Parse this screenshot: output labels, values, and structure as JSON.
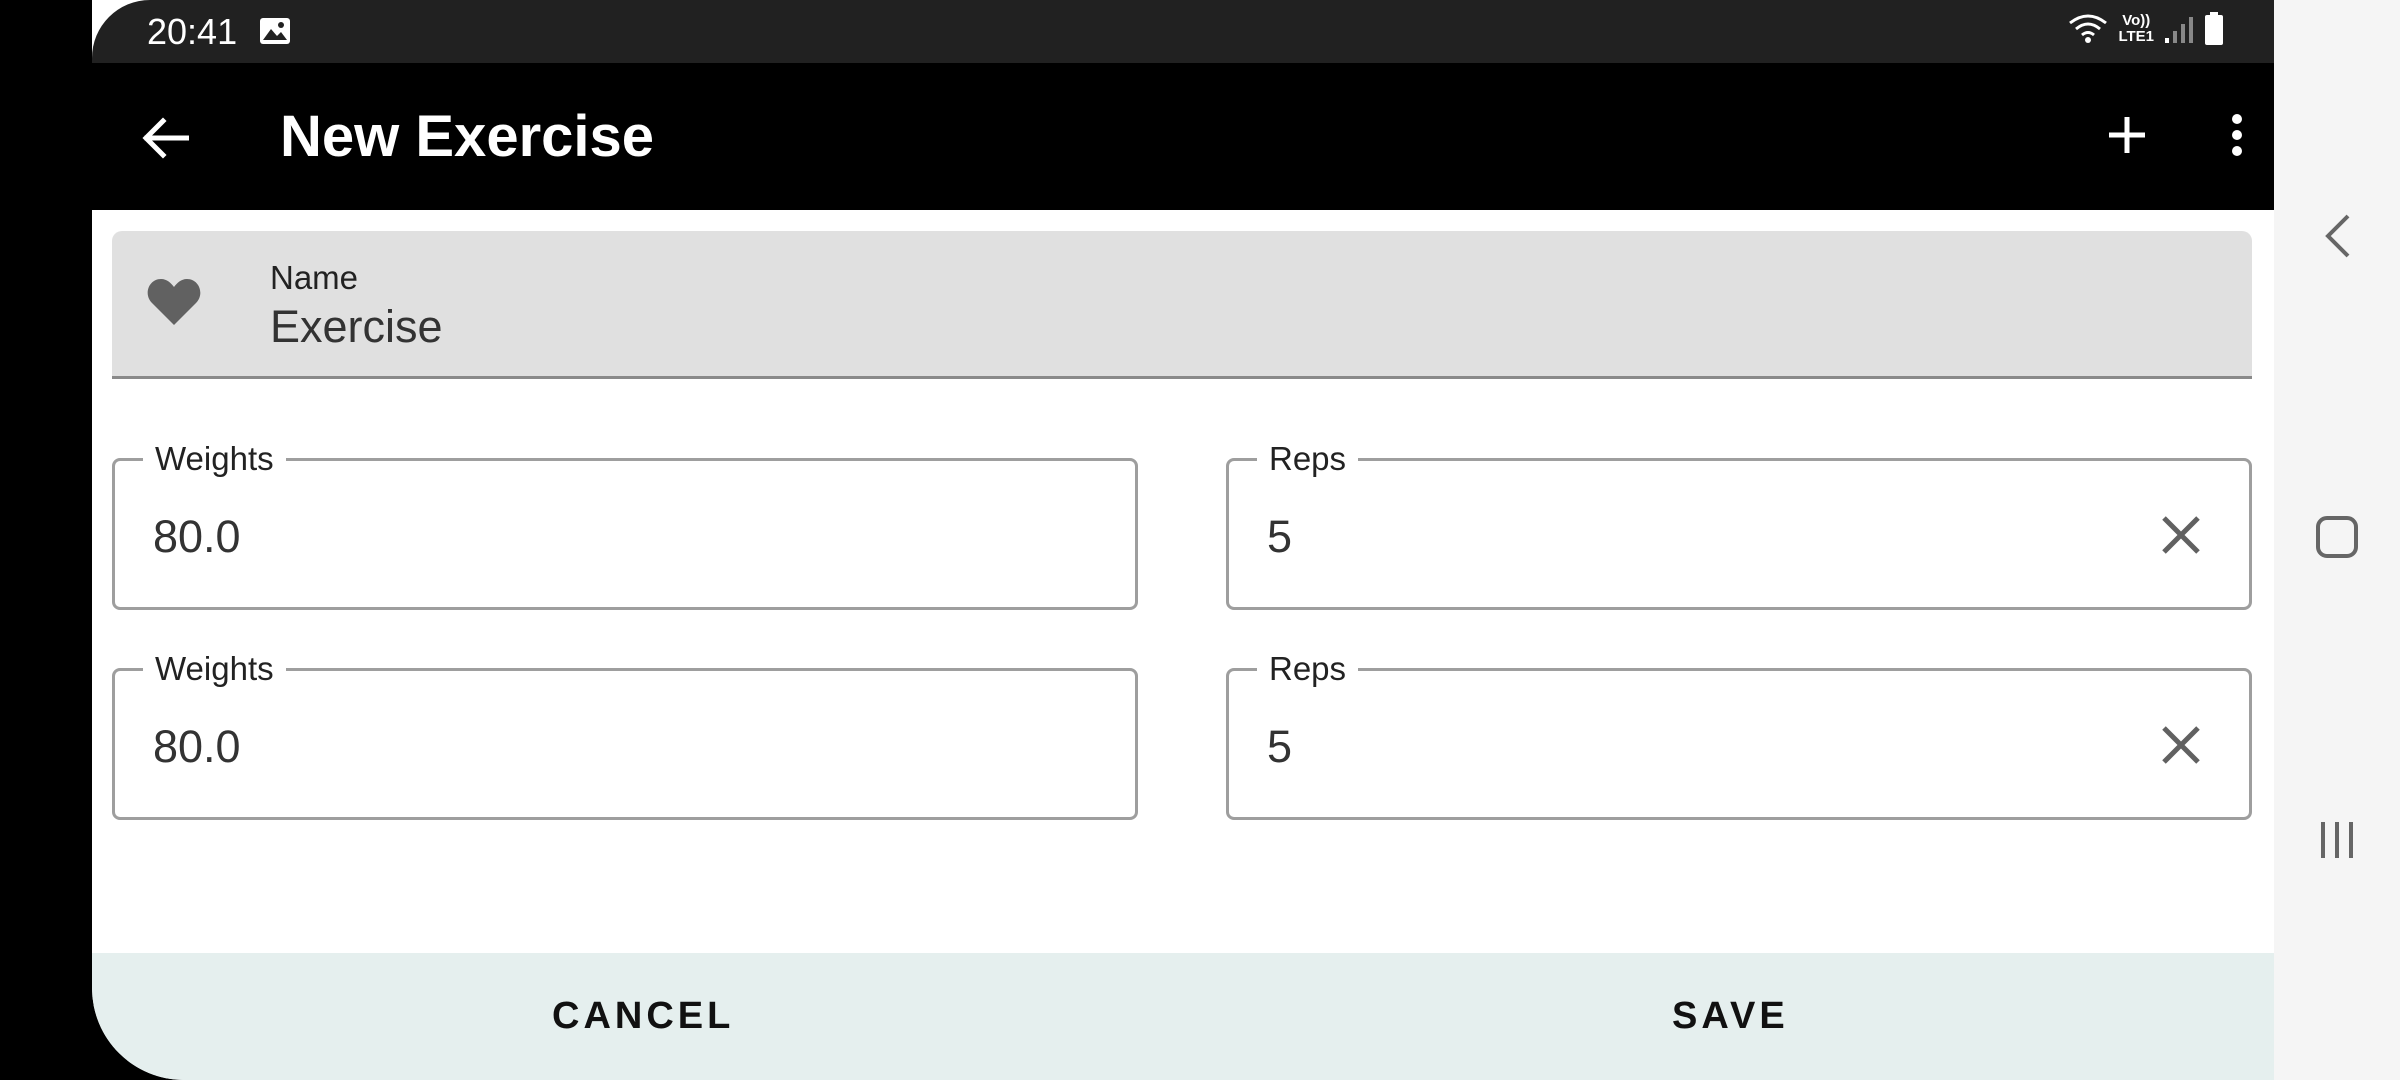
{
  "status_bar": {
    "time": "20:41",
    "gallery_icon": "image-icon",
    "network_label": "Vo)) LTE1",
    "volte_line1": "Vo))",
    "volte_line2": "LTE1"
  },
  "app_bar": {
    "title": "New Exercise",
    "back_icon": "arrow-back-icon",
    "add_icon": "plus-icon",
    "menu_icon": "more-vert-icon"
  },
  "form": {
    "name": {
      "label": "Name",
      "value": "Exercise",
      "icon": "heart-icon"
    },
    "sets": [
      {
        "weights_label": "Weights",
        "weights_value": "80.0",
        "reps_label": "Reps",
        "reps_value": "5"
      },
      {
        "weights_label": "Weights",
        "weights_value": "80.0",
        "reps_label": "Reps",
        "reps_value": "5"
      }
    ]
  },
  "actions": {
    "cancel_label": "CANCEL",
    "save_label": "SAVE"
  },
  "nav_bar": {
    "back_icon": "chevron-left-icon",
    "home_icon": "square-icon",
    "recents_icon": "recents-icon"
  },
  "colors": {
    "app_bar_bg": "#000000",
    "name_field_bg": "#e0e0e0",
    "button_bar_bg": "#e5efee",
    "outline": "#9e9e9e"
  }
}
